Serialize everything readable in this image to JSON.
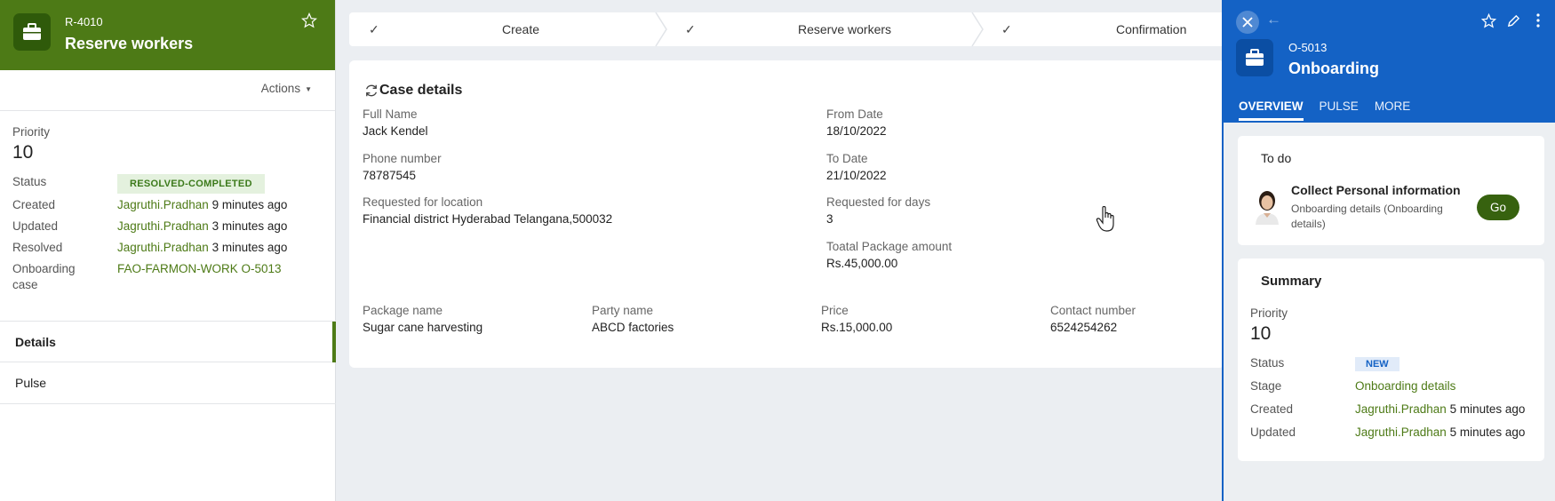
{
  "left_panel": {
    "case_id": "R-4010",
    "title": "Reserve workers",
    "actions_label": "Actions",
    "priority_label": "Priority",
    "priority_value": "10",
    "status_label": "Status",
    "status_value": "RESOLVED-COMPLETED",
    "created_label": "Created",
    "created_user": "Jagruthi.Pradhan",
    "created_time": "9 minutes ago",
    "updated_label": "Updated",
    "updated_user": "Jagruthi.Pradhan",
    "updated_time": "3 minutes ago",
    "resolved_label": "Resolved",
    "resolved_user": "Jagruthi.Pradhan",
    "resolved_time": "3 minutes ago",
    "onboarding_label_1": "Onboarding",
    "onboarding_label_2": "case",
    "onboarding_value": "FAO-FARMON-WORK O-5013",
    "nav_details": "Details",
    "nav_pulse": "Pulse"
  },
  "stepper": {
    "steps": [
      {
        "label": "Create"
      },
      {
        "label": "Reserve workers"
      },
      {
        "label": "Confirmation"
      }
    ]
  },
  "case_details": {
    "title": "Case details",
    "full_name_label": "Full Name",
    "full_name": "Jack Kendel",
    "phone_label": "Phone number",
    "phone": "78787545",
    "location_label": "Requested for location",
    "location": "Financial district Hyderabad Telangana,500032",
    "from_label": "From Date",
    "from": "18/10/2022",
    "to_label": "To Date",
    "to": "21/10/2022",
    "days_label": "Requested for days",
    "days": "3",
    "total_label": "Toatal Package amount",
    "total": "Rs.45,000.00",
    "package_label": "Package name",
    "package": "Sugar cane harvesting",
    "party_label": "Party name",
    "party": "ABCD factories",
    "price_label": "Price",
    "price": "Rs.15,000.00",
    "contact_label": "Contact number",
    "contact": "6524254262"
  },
  "right_panel": {
    "case_id": "O-5013",
    "title": "Onboarding",
    "tabs": [
      "OVERVIEW",
      "PULSE",
      "MORE"
    ],
    "todo": {
      "title": "To do",
      "task": "Collect Personal information",
      "subtitle": "Onboarding details (Onboarding details)",
      "go_label": "Go"
    },
    "summary": {
      "title": "Summary",
      "priority_label": "Priority",
      "priority_value": "10",
      "status_label": "Status",
      "status_value": "NEW",
      "stage_label": "Stage",
      "stage_value": "Onboarding details",
      "created_label": "Created",
      "created_user": "Jagruthi.Pradhan",
      "created_time": "5 minutes ago",
      "updated_label": "Updated",
      "updated_user": "Jagruthi.Pradhan",
      "updated_time": "5 minutes ago"
    }
  },
  "colors": {
    "left_header": "#4d7a16",
    "right_header": "#1462c5",
    "go_button": "#37620f"
  }
}
